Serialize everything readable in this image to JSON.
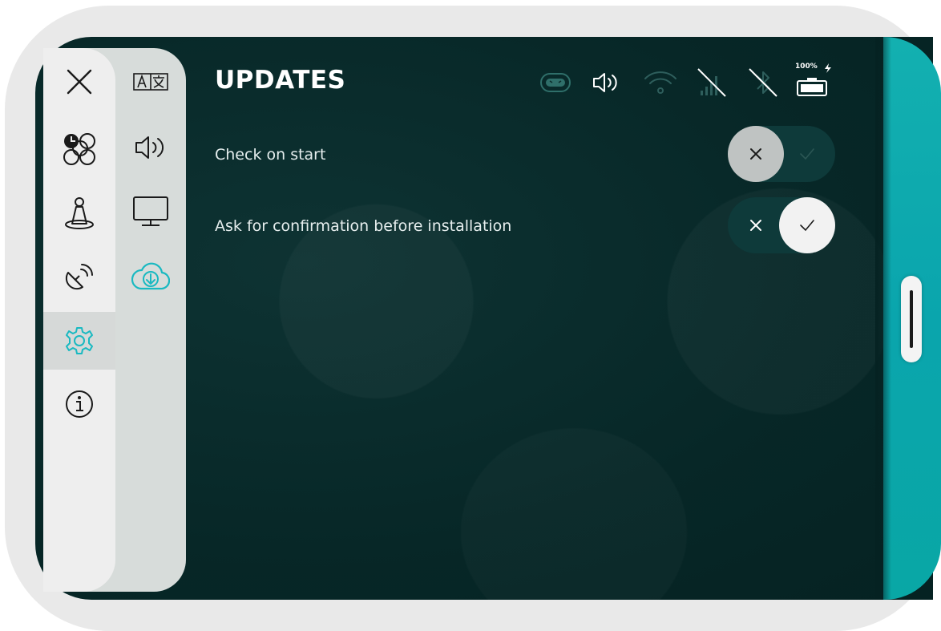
{
  "page": {
    "title": "UPDATES"
  },
  "status": {
    "battery_label": "100%",
    "icons": [
      "robot-face-icon",
      "speaker-icon",
      "wifi-icon",
      "cellular-off-icon",
      "bluetooth-off-icon",
      "battery-icon",
      "charging-bolt-icon"
    ]
  },
  "main_nav": [
    {
      "name": "close",
      "icon": "close-icon"
    },
    {
      "name": "apps",
      "icon": "apps-clock-icon"
    },
    {
      "name": "robot-position",
      "icon": "person-on-platform-icon"
    },
    {
      "name": "remote",
      "icon": "satellite-dish-icon"
    },
    {
      "name": "settings",
      "icon": "gear-icon",
      "active": true
    },
    {
      "name": "info",
      "icon": "info-icon"
    }
  ],
  "sub_nav": [
    {
      "name": "language",
      "icon": "translate-icon"
    },
    {
      "name": "sound",
      "icon": "speaker-icon"
    },
    {
      "name": "display",
      "icon": "monitor-icon"
    },
    {
      "name": "updates",
      "icon": "cloud-download-icon",
      "active": true
    }
  ],
  "settings": [
    {
      "label": "Check on start",
      "value": false
    },
    {
      "label": "Ask for confirmation before installation",
      "value": true
    }
  ],
  "colors": {
    "accent": "#19b9c1",
    "panel": "#eeeeee",
    "sub_panel": "#d7dcda",
    "screen_bg": "#072727"
  }
}
